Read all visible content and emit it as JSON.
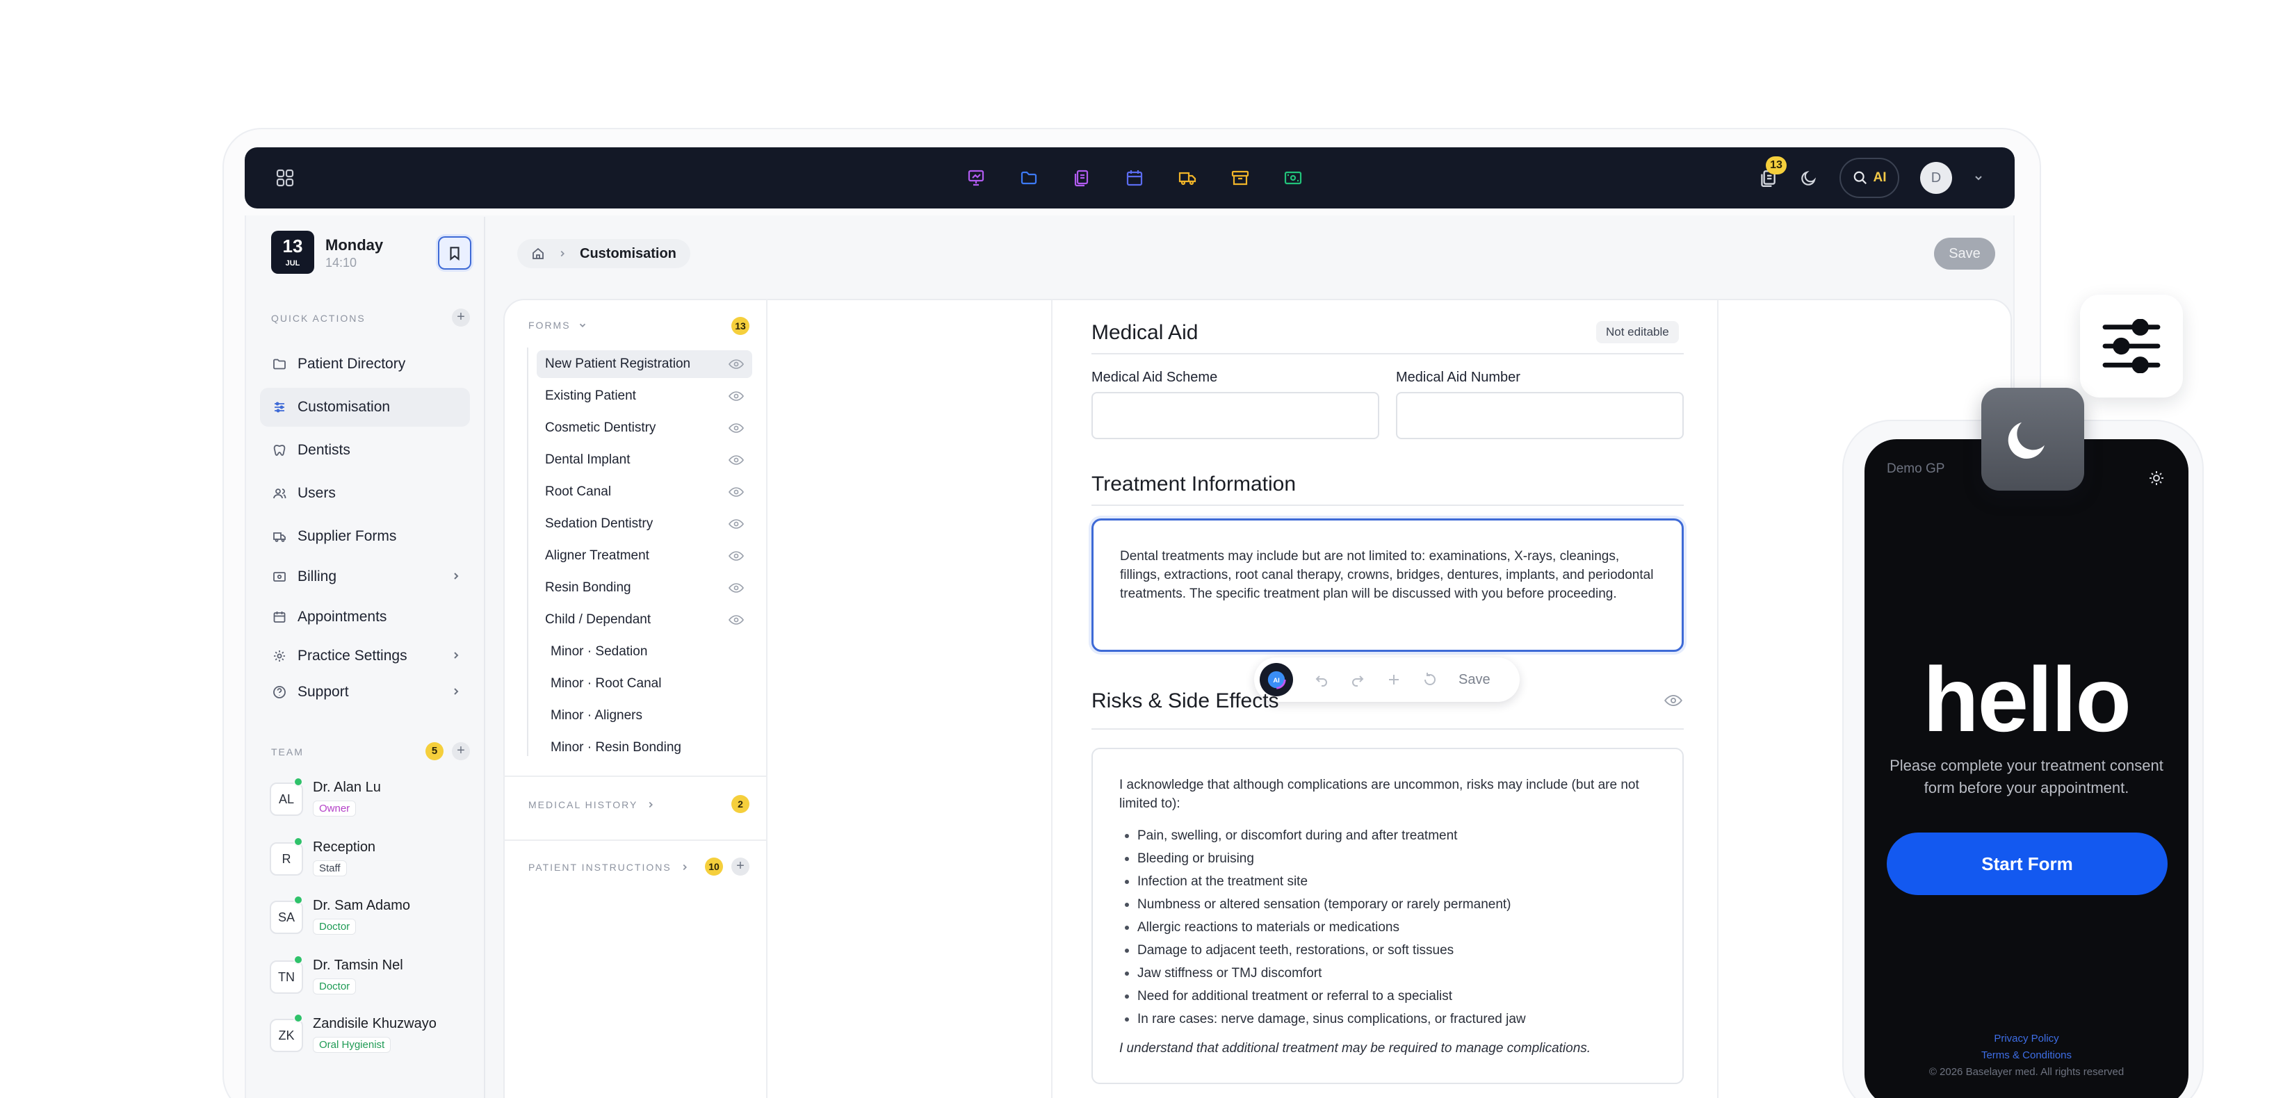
{
  "topbar": {
    "stack_badge": "13",
    "search_ai": "AI",
    "avatar_initial": "D"
  },
  "sidebar": {
    "date_day": "13",
    "date_month": "JUL",
    "weekday": "Monday",
    "time": "14:10",
    "quick_actions_label": "QUICK ACTIONS",
    "items": [
      {
        "label": "Patient Directory"
      },
      {
        "label": "Customisation"
      },
      {
        "label": "Dentists"
      },
      {
        "label": "Users"
      },
      {
        "label": "Supplier Forms"
      },
      {
        "label": "Billing"
      },
      {
        "label": "Appointments"
      },
      {
        "label": "Practice Settings"
      },
      {
        "label": "Support"
      }
    ],
    "team_label": "TEAM",
    "team_count": "5",
    "team": [
      {
        "initials": "AL",
        "name": "Dr. Alan Lu",
        "role": "Owner"
      },
      {
        "initials": "R",
        "name": "Reception",
        "role": "Staff"
      },
      {
        "initials": "SA",
        "name": "Dr. Sam Adamo",
        "role": "Doctor"
      },
      {
        "initials": "TN",
        "name": "Dr. Tamsin Nel",
        "role": "Doctor"
      },
      {
        "initials": "ZK",
        "name": "Zandisile Khuzwayo",
        "role": "Oral Hygienist"
      }
    ]
  },
  "breadcrumb": {
    "current": "Customisation"
  },
  "header": {
    "save_label": "Save"
  },
  "forms": {
    "label": "FORMS",
    "count": "13",
    "items": [
      "New Patient Registration",
      "Existing Patient",
      "Cosmetic Dentistry",
      "Dental Implant",
      "Root Canal",
      "Sedation Dentistry",
      "Aligner Treatment",
      "Resin Bonding",
      "Child / Dependant"
    ],
    "sub_items": [
      "Minor · Sedation",
      "Minor · Root Canal",
      "Minor · Aligners",
      "Minor · Resin Bonding"
    ],
    "medical_history_label": "MEDICAL HISTORY",
    "medical_history_count": "2",
    "patient_instructions_label": "PATIENT INSTRUCTIONS",
    "patient_instructions_count": "10"
  },
  "document": {
    "medical_aid_title": "Medical Aid",
    "not_editable": "Not editable",
    "scheme_label": "Medical Aid Scheme",
    "number_label": "Medical Aid Number",
    "treatment_title": "Treatment Information",
    "treatment_text": "Dental treatments may include but are not limited to: examinations, X-rays, cleanings, fillings, extractions, root canal therapy, crowns, bridges, dentures, implants, and periodontal treatments. The specific treatment plan will be discussed with you before proceeding.",
    "toolbar_save": "Save",
    "toolbar_logo": "AI",
    "risks_title": "Risks & Side Effects",
    "risks_intro": "I acknowledge that although complications are uncommon, risks may include (but are not limited to):",
    "risks": [
      "Pain, swelling, or discomfort during and after treatment",
      "Bleeding or bruising",
      "Infection at the treatment site",
      "Numbness or altered sensation (temporary or rarely permanent)",
      "Allergic reactions to materials or medications",
      "Damage to adjacent teeth, restorations, or soft tissues",
      "Jaw stiffness or TMJ discomfort",
      "Need for additional treatment or referral to a specialist",
      "In rare cases: nerve damage, sinus complications, or fractured jaw"
    ],
    "risks_note": "I understand that additional treatment may be required to manage complications."
  },
  "phone": {
    "brand": "Demo GP",
    "hello": "hello",
    "subtitle": "Please complete your treatment consent form before your appointment.",
    "start_label": "Start Form",
    "privacy": "Privacy Policy",
    "terms": "Terms & Conditions",
    "copyright": "© 2026 Baselayer med. All rights reserved"
  },
  "colors": {
    "accent": "#3e6ad6",
    "start_button": "#1359f0",
    "badge": "#f5cf3c",
    "topbar": "#131826"
  }
}
